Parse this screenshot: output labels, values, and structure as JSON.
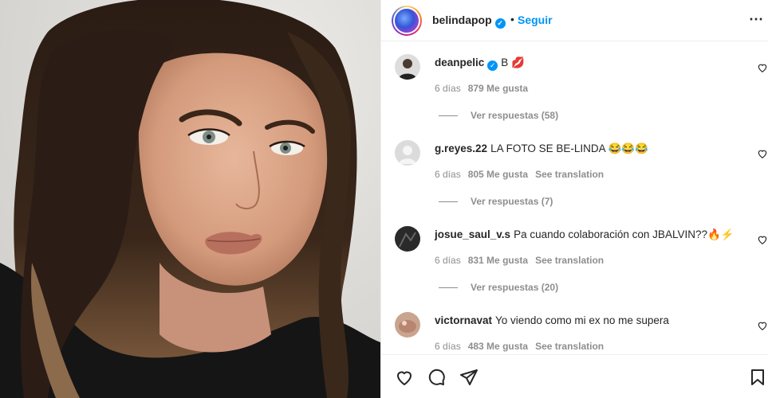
{
  "post": {
    "username": "belindapop",
    "separator": "•",
    "follow_label": "Seguir",
    "more_icon": "more-horizontal-icon",
    "photo_description_icon": "portrait-photo"
  },
  "comments": [
    {
      "username": "deanpelic",
      "verified": true,
      "text": "B 💋",
      "time": "6 días",
      "likes": "879 Me gusta",
      "translate": "",
      "replies": "Ver respuestas (58)"
    },
    {
      "username": "g.reyes.22",
      "verified": false,
      "text": "LA FOTO SE BE-LINDA 😂😂😂",
      "time": "6 días",
      "likes": "805 Me gusta",
      "translate": "See translation",
      "replies": "Ver respuestas (7)"
    },
    {
      "username": "josue_saul_v.s",
      "verified": false,
      "text": "Pa cuando colaboración con JBALVIN??🔥⚡",
      "time": "6 días",
      "likes": "831 Me gusta",
      "translate": "See translation",
      "replies": "Ver respuestas (20)"
    },
    {
      "username": "victornavat",
      "verified": false,
      "text": "Yo viendo como mi ex no me supera",
      "time": "6 días",
      "likes": "483 Me gusta",
      "translate": "See translation",
      "replies": ""
    }
  ],
  "colors": {
    "accent": "#0095f6",
    "text": "#262626",
    "muted": "#8e8e8e"
  },
  "actions": {
    "icons": [
      "heart-icon",
      "comment-icon",
      "share-icon",
      "save-icon"
    ]
  }
}
